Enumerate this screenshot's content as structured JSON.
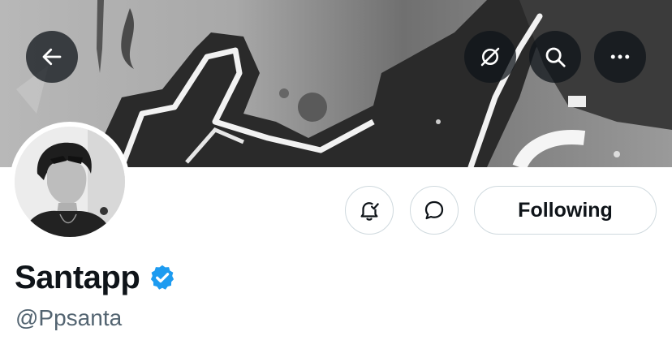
{
  "profile": {
    "display_name": "Santapp",
    "handle": "@Ppsanta",
    "verified": true,
    "following_label": "Following"
  },
  "icons": {
    "back": "arrow-left-icon",
    "hide_banner": "eye-slash-icon",
    "search": "search-icon",
    "more": "more-horizontal-icon",
    "notifications": "bell-check-icon",
    "message": "message-bubble-icon",
    "verified": "verified-badge-icon"
  },
  "colors": {
    "text_primary": "#0f1419",
    "text_secondary": "#536471",
    "border": "#cfd9de",
    "verified_blue": "#1d9bf0",
    "overlay_button": "rgba(15,20,25,0.75)"
  }
}
